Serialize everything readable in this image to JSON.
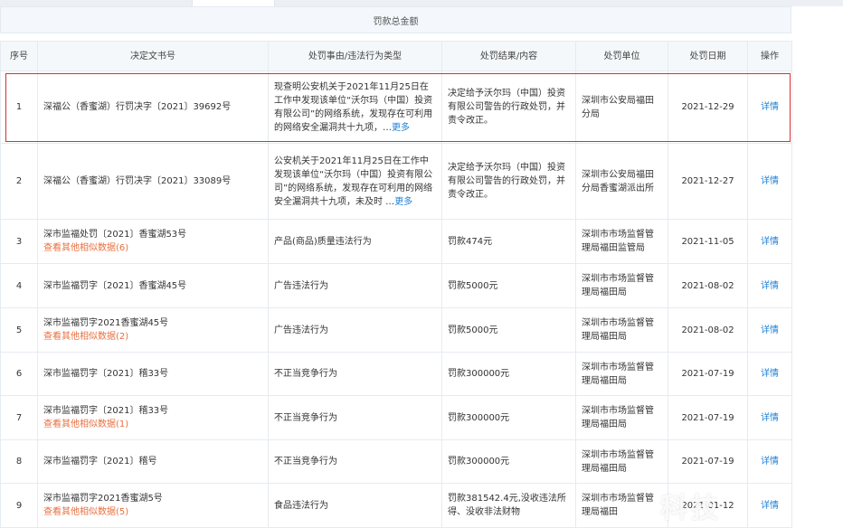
{
  "summary": {
    "label": "罚款总金额"
  },
  "columns": [
    "序号",
    "决定文书号",
    "处罚事由/违法行为类型",
    "处罚结果/内容",
    "处罚单位",
    "处罚日期",
    "操作"
  ],
  "rows": [
    {
      "index": "1",
      "doc_no": "深福公（香蜜湖）行罚决字〔2021〕39692号",
      "doc_sub": "",
      "reason": "现查明公安机关于2021年11月25日在工作中发现该单位“沃尔玛（中国）投资有限公司”的网络系统，发现存在可利用的网络安全漏洞共十九项，…",
      "reason_more": "更多",
      "result": "决定给予沃尔玛（中国）投资有限公司警告的行政处罚，并责令改正。",
      "unit": "深圳市公安局福田分局",
      "date": "2021-12-29",
      "op": "详情"
    },
    {
      "index": "2",
      "doc_no": "深福公（香蜜湖）行罚决字〔2021〕33089号",
      "doc_sub": "",
      "reason": "公安机关于2021年11月25日在工作中发现该单位“沃尔玛（中国）投资有限公司”的网络系统，发现存在可利用的网络安全漏洞共十九项，未及时 …",
      "reason_more": "更多",
      "result": "决定给予沃尔玛（中国）投资有限公司警告的行政处罚，并责令改正。",
      "unit": "深圳市公安局福田分局香蜜湖派出所",
      "date": "2021-12-27",
      "op": "详情"
    },
    {
      "index": "3",
      "doc_no": "深市监福处罚〔2021〕香蜜湖53号",
      "doc_sub": "查看其他相似数据(6)",
      "reason": "产品(商品)质量违法行为",
      "reason_more": "",
      "result": "罚款474元",
      "unit": "深圳市市场监督管理局福田监管局",
      "date": "2021-11-05",
      "op": "详情"
    },
    {
      "index": "4",
      "doc_no": "深市监福罚字〔2021〕香蜜湖45号",
      "doc_sub": "",
      "reason": "广告违法行为",
      "reason_more": "",
      "result": "罚款5000元",
      "unit": "深圳市市场监督管理局福田局",
      "date": "2021-08-02",
      "op": "详情"
    },
    {
      "index": "5",
      "doc_no": "深市监福罚字2021香蜜湖45号",
      "doc_sub": "查看其他相似数据(2)",
      "reason": "广告违法行为",
      "reason_more": "",
      "result": "罚款5000元",
      "unit": "深圳市市场监督管理局福田局",
      "date": "2021-08-02",
      "op": "详情"
    },
    {
      "index": "6",
      "doc_no": "深市监福罚字〔2021〕稽33号",
      "doc_sub": "",
      "reason": "不正当竞争行为",
      "reason_more": "",
      "result": "罚款300000元",
      "unit": "深圳市市场监督管理局福田局",
      "date": "2021-07-19",
      "op": "详情"
    },
    {
      "index": "7",
      "doc_no": "深市监福罚字〔2021〕稽33号",
      "doc_sub": "查看其他相似数据(1)",
      "reason": "不正当竞争行为",
      "reason_more": "",
      "result": "罚款300000元",
      "unit": "深圳市市场监督管理局福田局",
      "date": "2021-07-19",
      "op": "详情"
    },
    {
      "index": "8",
      "doc_no": "深市监福罚字〔2021〕稽号",
      "doc_sub": "",
      "reason": "不正当竞争行为",
      "reason_more": "",
      "result": "罚款300000元",
      "unit": "深圳市市场监督管理局福田局",
      "date": "2021-07-19",
      "op": "详情"
    },
    {
      "index": "9",
      "doc_no": "深市监福罚字2021香蜜湖5号",
      "doc_sub": "查看其他相似数据(5)",
      "reason": "食品违法行为",
      "reason_more": "",
      "result": "罚款381542.4元,没收违法所得、没收非法财物",
      "unit": "深圳市市场监督管理局福田",
      "date": "2021-01-12",
      "op": "详情"
    }
  ],
  "watermark": "科技"
}
